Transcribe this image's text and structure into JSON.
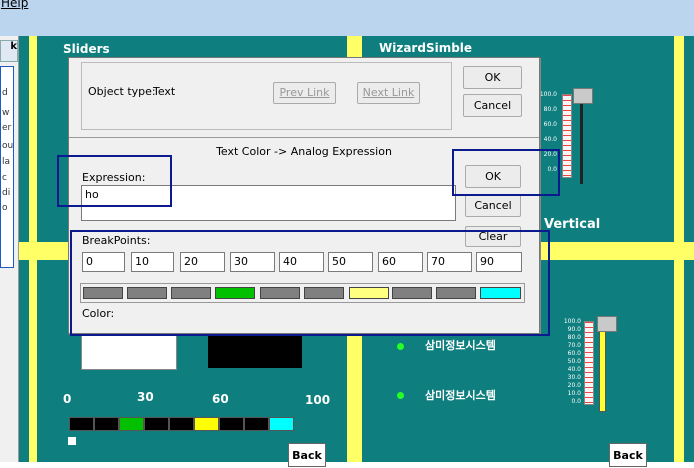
{
  "menu": {
    "help": "Help"
  },
  "left_panel": {
    "tab_label": "k",
    "letters": [
      "d",
      "w",
      "er",
      "ou",
      "la",
      "c",
      "di",
      "o"
    ]
  },
  "canvas": {
    "sliders_title": "Sliders",
    "wizard_title": "WizardSimble",
    "vertical_label": "Vertical",
    "korean_1": "삼미정보시스템",
    "korean_2": "삼미정보시스템",
    "scale_top": [
      "100.0",
      "80.0",
      "60.0",
      "40.0",
      "20.0",
      "0.0"
    ],
    "scale_bottom": [
      "100.0",
      "90.0",
      "80.0",
      "70.0",
      "60.0",
      "50.0",
      "40.0",
      "30.0",
      "20.0",
      "10.0",
      "0.0"
    ],
    "hbar_labels": [
      "0",
      "30",
      "60",
      "100"
    ],
    "back_left": "Back",
    "back_right": "Back"
  },
  "dialog": {
    "object_type_label": "Object type:",
    "object_type_value": "Text",
    "prev_link": "Prev Link",
    "next_link": "Next Link",
    "ok_top": "OK",
    "cancel_top": "Cancel",
    "section_title": "Text Color -> Analog Expression",
    "expression_label": "Expression:",
    "expression_value": "ho",
    "ok": "OK",
    "cancel": "Cancel",
    "clear": "Clear",
    "breakpoints_label": "BreakPoints:",
    "breakpoints": [
      "0",
      "10",
      "20",
      "30",
      "40",
      "50",
      "60",
      "70",
      "90"
    ],
    "color_label": "Color:",
    "colors": [
      "#808080",
      "#808080",
      "#808080",
      "#00c000",
      "#808080",
      "#808080",
      "#ffff80",
      "#808080",
      "#808080",
      "#00ffff"
    ]
  }
}
